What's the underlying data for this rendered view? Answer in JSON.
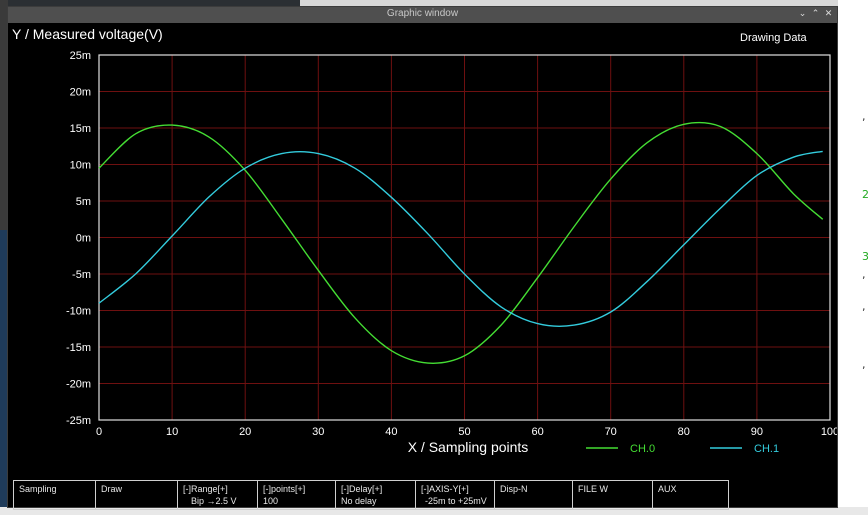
{
  "window": {
    "title": "Graphic window",
    "controls": [
      "⌄",
      "⌃",
      "✕"
    ]
  },
  "plot": {
    "y_title": "Y / Measured voltage(V)",
    "x_title": "X / Sampling points",
    "header_right": "Drawing Data",
    "y_ticks": [
      "25m",
      "20m",
      "15m",
      "10m",
      "5m",
      "0m",
      "-5m",
      "-10m",
      "-15m",
      "-20m",
      "-25m"
    ],
    "x_ticks": [
      "0",
      "10",
      "20",
      "30",
      "40",
      "50",
      "60",
      "70",
      "80",
      "90",
      "100"
    ],
    "legend": [
      {
        "label": "CH.0",
        "color": "#44dd33"
      },
      {
        "label": "CH.1",
        "color": "#33ccdd"
      }
    ],
    "colors": {
      "grid": "#6e1010",
      "frame": "#e0e0e0",
      "background": "#000000"
    }
  },
  "chart_data": {
    "type": "line",
    "title": "",
    "xlabel": "X / Sampling points",
    "ylabel": "Y / Measured voltage(V)",
    "xlim": [
      0,
      100
    ],
    "ylim": [
      -25,
      25
    ],
    "y_unit": "m",
    "grid": true,
    "legend_position": "bottom-right",
    "series": [
      {
        "name": "CH.0",
        "color": "#44dd33",
        "x": [
          0,
          5,
          10,
          15,
          20,
          25,
          30,
          35,
          40,
          45,
          50,
          55,
          60,
          65,
          70,
          75,
          80,
          85,
          90,
          95,
          99
        ],
        "values": [
          9.5,
          14.2,
          15.4,
          13.8,
          9.2,
          2.5,
          -4.5,
          -11.0,
          -15.5,
          -17.2,
          -16.2,
          -12.0,
          -5.5,
          1.5,
          8.0,
          13.0,
          15.5,
          15.2,
          11.5,
          6.0,
          2.5
        ]
      },
      {
        "name": "CH.1",
        "color": "#33ccdd",
        "x": [
          0,
          5,
          10,
          15,
          20,
          25,
          30,
          35,
          40,
          45,
          50,
          55,
          60,
          65,
          70,
          75,
          80,
          85,
          90,
          95,
          99
        ],
        "values": [
          -9.0,
          -5.0,
          0.2,
          5.5,
          9.5,
          11.5,
          11.5,
          9.5,
          5.5,
          0.5,
          -5.0,
          -9.5,
          -11.8,
          -12.0,
          -10.2,
          -6.0,
          -1.0,
          4.0,
          8.5,
          11.0,
          11.8
        ]
      }
    ]
  },
  "panel": {
    "cells": [
      {
        "line1": "Sampling",
        "line2": "",
        "name": "sampling-button"
      },
      {
        "line1": "Draw",
        "line2": "",
        "name": "draw-button"
      },
      {
        "line1": "[-]Range[+]",
        "line2": "Bip →2.5 V",
        "name": "range-button"
      },
      {
        "line1": "[-]points[+]",
        "line2": "100",
        "name": "points-button"
      },
      {
        "line1": "[-]Delay[+]",
        "line2": "No delay",
        "name": "delay-button"
      },
      {
        "line1": "[-]AXIS-Y[+]",
        "line2": "-25m to +25mV",
        "name": "axis-y-button"
      },
      {
        "line1": "Disp-N",
        "line2": "",
        "name": "disp-n-button"
      },
      {
        "line1": "FILE W",
        "line2": "",
        "name": "file-w-button"
      },
      {
        "line1": "AUX",
        "line2": "",
        "name": "aux-button"
      }
    ]
  }
}
